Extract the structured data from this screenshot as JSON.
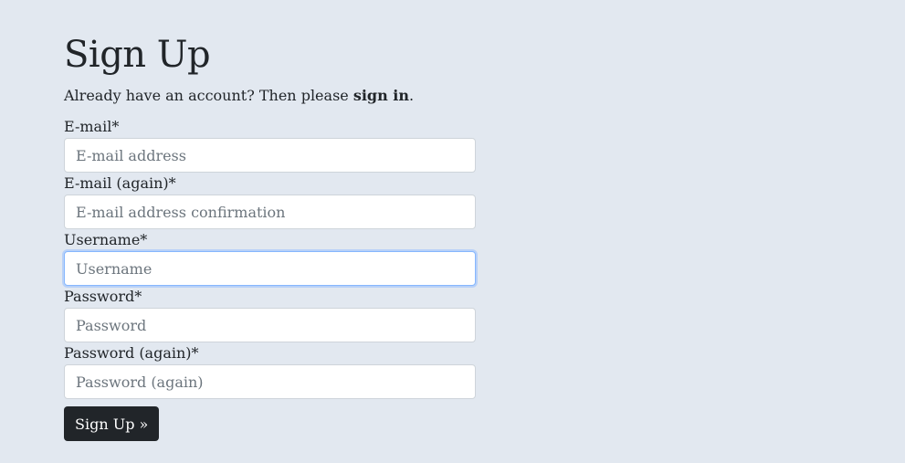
{
  "page": {
    "title": "Sign Up",
    "lead_prefix": "Already have an account? Then please ",
    "lead_link": "sign in",
    "lead_suffix": "."
  },
  "form": {
    "fields": [
      {
        "label": "E-mail*",
        "placeholder": "E-mail address",
        "type": "email",
        "value": ""
      },
      {
        "label": "E-mail (again)*",
        "placeholder": "E-mail address confirmation",
        "type": "email",
        "value": ""
      },
      {
        "label": "Username*",
        "placeholder": "Username",
        "type": "text",
        "value": "",
        "focused": true
      },
      {
        "label": "Password*",
        "placeholder": "Password",
        "type": "password",
        "value": ""
      },
      {
        "label": "Password (again)*",
        "placeholder": "Password (again)",
        "type": "password",
        "value": ""
      }
    ],
    "submit_label": "Sign Up »"
  },
  "colors": {
    "background": "#e2e8f0",
    "button": "#212529",
    "focus_ring": "#86b7fe"
  }
}
